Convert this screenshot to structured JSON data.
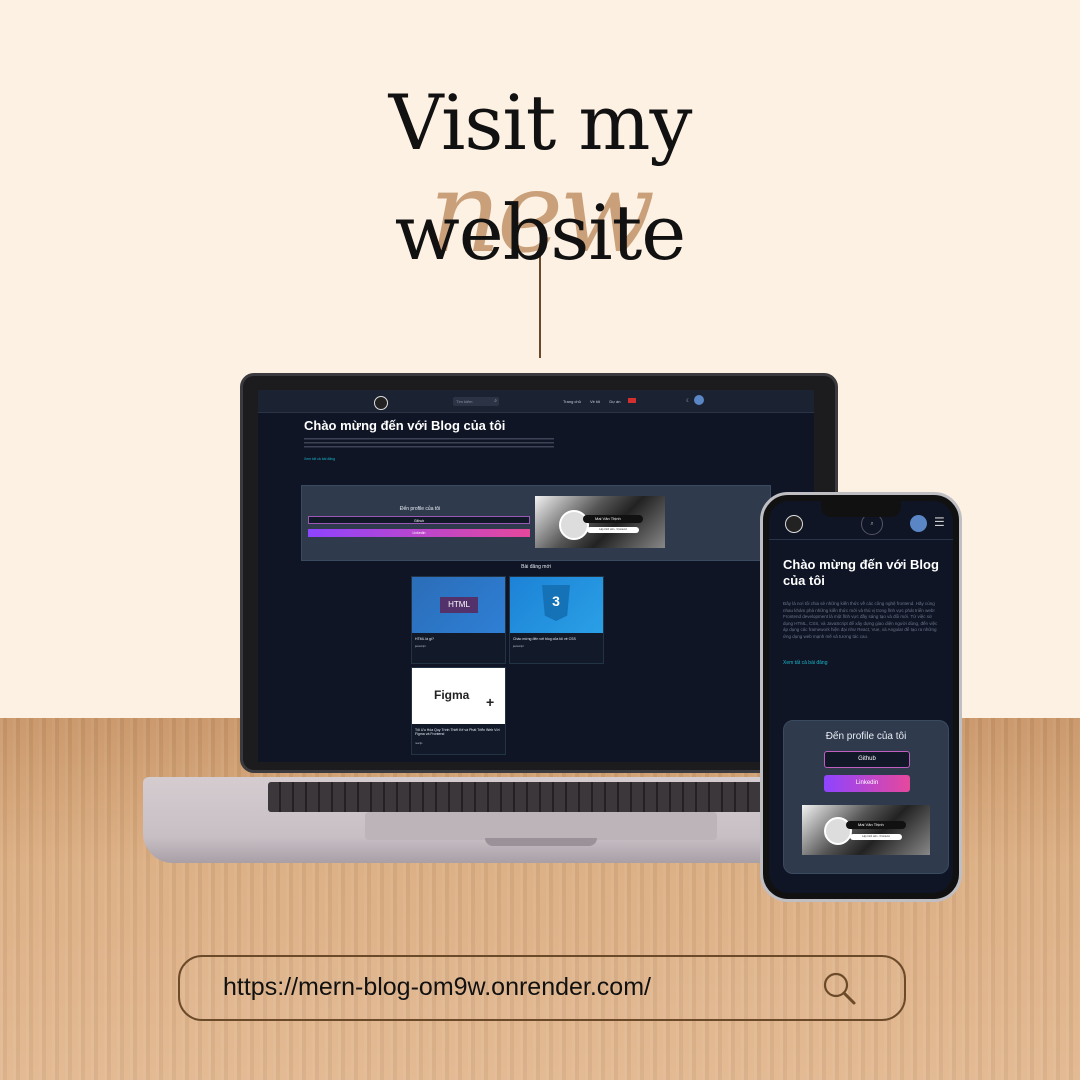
{
  "headline": {
    "line1": "Visit my",
    "accent": "new",
    "line2": "website"
  },
  "laptop_site": {
    "search_placeholder": "Tìm kiếm",
    "nav": [
      "Trang chủ",
      "Về tôi",
      "Dự án"
    ],
    "title": "Chào mừng đến với Blog của tôi",
    "see_all": "Xem tất cả bài đăng",
    "profile": {
      "heading": "Đến profile của tôi",
      "github": "Github",
      "linkedin": "Linkedin",
      "card_name": "Mai Văn Thịnh",
      "card_sub": "Lập trình viên · Frontend"
    },
    "posts_heading": "Bài đăng mới",
    "posts": [
      {
        "image_text": "HTML",
        "title": "HTML là gì?",
        "category": "javascript"
      },
      {
        "image_text": "3",
        "title": "Chào mừng đến với blog của tôi về CSS",
        "category": "javascript"
      },
      {
        "image_text": "Figma",
        "title": "Tối Ưu Hóa Quy Trình Thiết Kế và Phát Triển Web Với Figma và Frontend",
        "category": "reactjs"
      }
    ]
  },
  "phone_site": {
    "title": "Chào mừng đến với Blog của tôi",
    "paragraph": "Đây là nơi tôi chia sẻ những kiến thức về các công nghệ frontend. Hãy cùng nhau khám phá những kiến thức mới và thú vị trong lĩnh vực phát triển web! Frontend development là một lĩnh vực đầy sáng tạo và đổi mới. Từ việc sử dụng HTML, CSS, và JavaScript để xây dựng giao diện người dùng, đến việc áp dụng các framework hiện đại như React, Vue, và Angular để tạo ra những ứng dụng web mạnh mẽ và tương tác cao.",
    "see_all": "Xem tất cả bài đăng",
    "profile_heading": "Đến profile của tôi",
    "github": "Github",
    "linkedin": "Linkedin",
    "card_name": "Mai Văn Thịnh",
    "card_sub": "Lập trình viên · Frontend"
  },
  "url": "https://mern-blog-om9w.onrender.com/",
  "colors": {
    "background": "#fdf1e3",
    "accent": "#c9a07a",
    "site_bg": "#0f1525",
    "brown": "#6b4a2a"
  }
}
